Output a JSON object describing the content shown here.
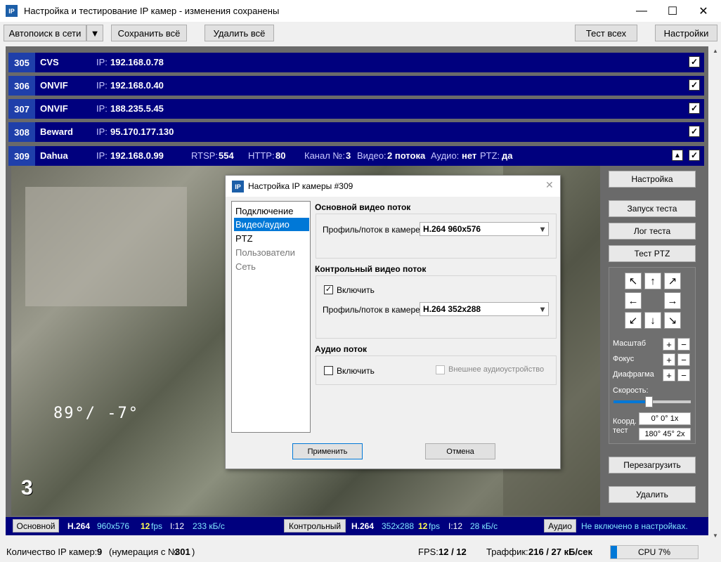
{
  "window": {
    "title": "Настройка и тестирование IP камер - изменения сохранены",
    "icon_text": "IP",
    "min": "—",
    "max": "☐",
    "close": "✕"
  },
  "toolbar": {
    "autosearch": "Автопоиск в сети",
    "save_all": "Сохранить всё",
    "delete_all": "Удалить всё",
    "test_all": "Тест всех",
    "settings": "Настройки"
  },
  "cameras": [
    {
      "num": "305",
      "name": "CVS",
      "ip_label": "IP:",
      "ip": "192.168.0.78"
    },
    {
      "num": "306",
      "name": "ONVIF",
      "ip_label": "IP:",
      "ip": "192.168.0.40"
    },
    {
      "num": "307",
      "name": "ONVIF",
      "ip_label": "IP:",
      "ip": "188.235.5.45"
    },
    {
      "num": "308",
      "name": "Beward",
      "ip_label": "IP:",
      "ip": "95.170.177.130"
    }
  ],
  "active": {
    "num": "309",
    "name": "Dahua",
    "ip_label": "IP:",
    "ip": "192.168.0.99",
    "rtsp_label": "RTSP:",
    "rtsp": "554",
    "http_label": "HTTP:",
    "http": "80",
    "channel_label": "Канал №:",
    "channel": "3",
    "video_label": "Видео:",
    "video": "2 потока",
    "audio_label": "Аудио:",
    "audio": "нет",
    "ptz_label": "PTZ:",
    "ptz": "да"
  },
  "overlay": {
    "coords": "89°/ -7°",
    "channel_num": "3"
  },
  "side": {
    "setup": "Настройка",
    "run_test": "Запуск теста",
    "test_log": "Лог теста",
    "test_ptz": "Тест PTZ",
    "zoom": "Масштаб",
    "focus": "Фокус",
    "iris": "Диафрагма",
    "speed": "Скорость:",
    "coord_l1": "Коорд.",
    "coord_l2": "тест",
    "coord1": "0° 0° 1x",
    "coord2": "180° 45° 2x",
    "reboot": "Перезагрузить",
    "delete": "Удалить",
    "speed_level": 0.45
  },
  "dialog": {
    "title": "Настройка IP камеры #309",
    "nav": [
      "Подключение",
      "Видео/аудио",
      "PTZ",
      "Пользователи",
      "Сеть"
    ],
    "main_stream": "Основной видео поток",
    "profile_label": "Профиль/поток в камере:",
    "main_profile": "H.264 960x576",
    "control_stream": "Контрольный видео поток",
    "enable": "Включить",
    "control_profile": "H.264 352x288",
    "audio_stream": "Аудио поток",
    "external_audio": "Внешнее аудиоустройство",
    "apply": "Применить",
    "cancel": "Отмена"
  },
  "bottom": {
    "main_btn": "Основной",
    "main_codec": "H.264",
    "main_res": "960x576",
    "main_fps": "12",
    "fps_unit": "fps",
    "main_i": "I:12",
    "main_rate": "233 кБ/с",
    "ctrl_btn": "Контрольный",
    "ctrl_codec": "H.264",
    "ctrl_res": "352x288",
    "ctrl_fps": "12",
    "ctrl_i": "I:12",
    "ctrl_rate": "28 кБ/с",
    "audio_btn": "Аудио",
    "audio_msg": "Не включено в настройках."
  },
  "status": {
    "count_label": "Количество IP камер:",
    "count": "9",
    "numbering_pre": "(нумерация с №",
    "numbering_num": "301",
    "numbering_post": ")",
    "fps_label": "FPS:",
    "fps": "12 / 12",
    "traffic_label": "Траффик:",
    "traffic": "216 / 27 кБ/сек",
    "cpu": "CPU 7%",
    "cpu_level": 0.07
  }
}
